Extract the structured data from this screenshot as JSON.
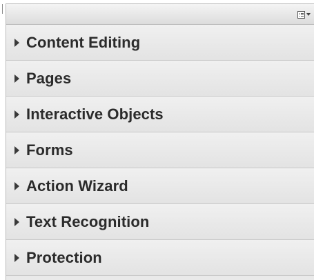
{
  "panel": {
    "options_icon": "list-options-icon",
    "sections": [
      {
        "label": "Content Editing",
        "icon": "expand-arrow-icon"
      },
      {
        "label": "Pages",
        "icon": "expand-arrow-icon"
      },
      {
        "label": "Interactive Objects",
        "icon": "expand-arrow-icon"
      },
      {
        "label": "Forms",
        "icon": "expand-arrow-icon"
      },
      {
        "label": "Action Wizard",
        "icon": "expand-arrow-icon"
      },
      {
        "label": "Text Recognition",
        "icon": "expand-arrow-icon"
      },
      {
        "label": "Protection",
        "icon": "expand-arrow-icon"
      }
    ]
  },
  "colors": {
    "panel_bg": "#e9e9e9",
    "label_text": "#2b2b2b",
    "divider": "#c9c9c9"
  }
}
